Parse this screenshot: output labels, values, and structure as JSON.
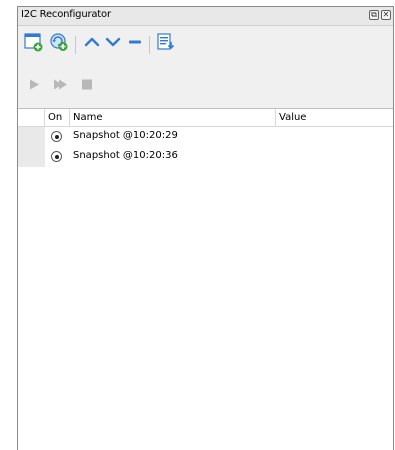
{
  "window": {
    "title": "I2C Reconfigurator",
    "float_button_glyph": "⧉",
    "close_button_glyph": "✕"
  },
  "toolbar": {
    "items": [
      {
        "icon": "new-snapshot-icon"
      },
      {
        "icon": "refresh-snapshot-icon"
      },
      {
        "icon": "move-up-icon"
      },
      {
        "icon": "move-down-icon"
      },
      {
        "icon": "remove-icon"
      },
      {
        "icon": "import-icon"
      }
    ]
  },
  "playback": {
    "items": [
      {
        "icon": "play-icon"
      },
      {
        "icon": "play-step-icon"
      },
      {
        "icon": "stop-icon"
      }
    ]
  },
  "table": {
    "columns": {
      "on": "On",
      "name": "Name",
      "value": "Value"
    },
    "rows": [
      {
        "on": true,
        "name": "Snapshot @10:20:29",
        "value": ""
      },
      {
        "on": true,
        "name": "Snapshot @10:20:36",
        "value": ""
      }
    ]
  },
  "colors": {
    "accent_blue": "#2f7bd3",
    "accent_green": "#3aa43a",
    "disabled_gray": "#a9a9a9"
  }
}
